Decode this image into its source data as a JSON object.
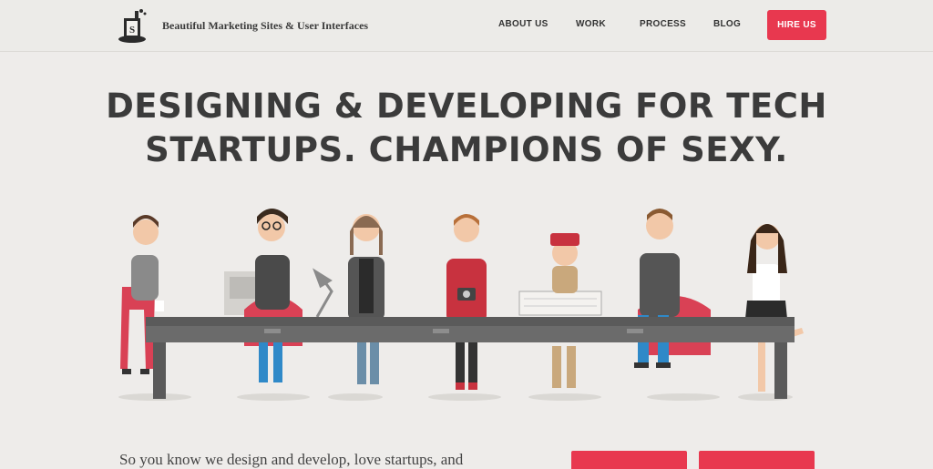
{
  "header": {
    "tagline": "Beautiful Marketing Sites & User Interfaces",
    "nav": [
      {
        "label": "ABOUT US"
      },
      {
        "label": "WORK"
      },
      {
        "label": "PROCESS"
      },
      {
        "label": "BLOG"
      }
    ],
    "hire_label": "HIRE US"
  },
  "hero": {
    "line1": "DESIGNING & DEVELOPING FOR TECH",
    "line2": "STARTUPS. CHAMPIONS OF SEXY."
  },
  "intro": {
    "text": "So you know we design and develop, love startups, and"
  },
  "colors": {
    "accent": "#e8384f",
    "background": "#eeecea",
    "text": "#3b3b3b"
  }
}
